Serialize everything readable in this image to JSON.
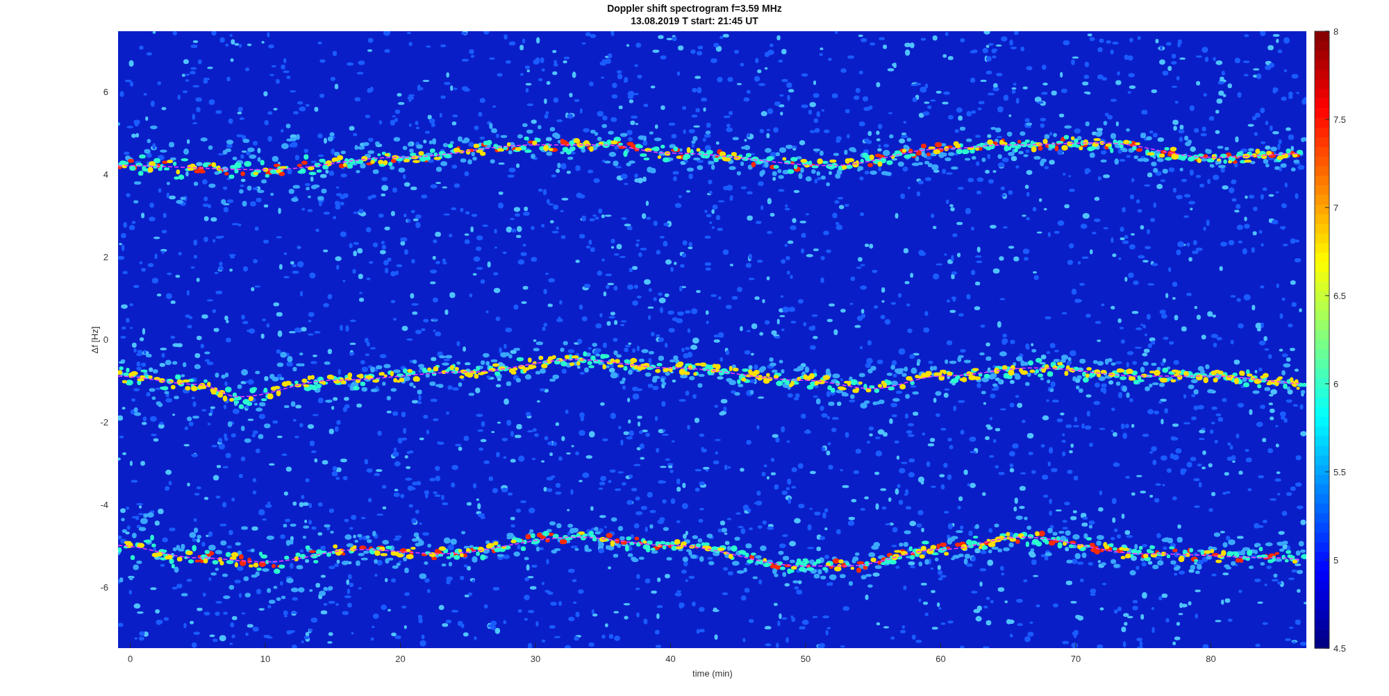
{
  "figure": {
    "title_lines": [
      "Doppler shift spectrogram f=3.59 MHz",
      "13.08.2019   T start: 21:45 UT"
    ],
    "spectrogram": {
      "xlabel": "time (min)",
      "ylabel": "Δf [Hz]",
      "xticks": [
        "0",
        "10",
        "20",
        "30",
        "40",
        "50",
        "60",
        "70",
        "80"
      ],
      "yticks": [
        "6",
        "4",
        "2",
        "0",
        "-2",
        "-4",
        "-6"
      ]
    },
    "colorbar": {
      "ticks": [
        "8",
        "7.5",
        "7",
        "6.5",
        "6",
        "5.5",
        "5",
        "4.5"
      ]
    }
  }
}
